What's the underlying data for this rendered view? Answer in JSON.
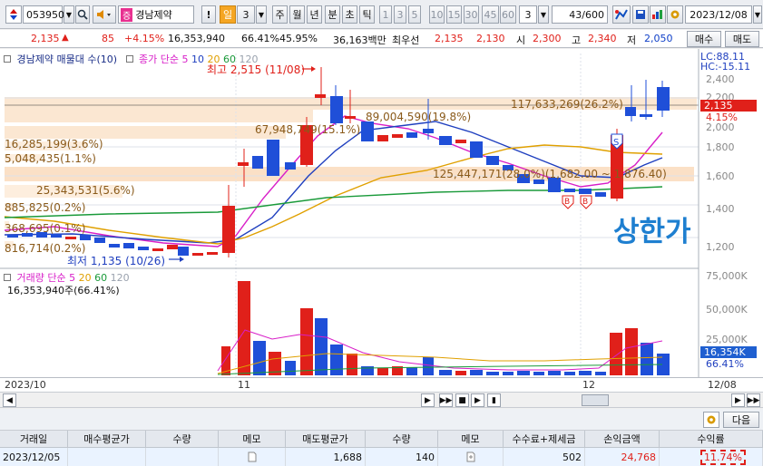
{
  "toolbar": {
    "code": "053950",
    "market_badge": "증",
    "stock_name": "경남제약",
    "exclaim": "!",
    "period_days": "일",
    "period_value": "3",
    "periods": [
      "주",
      "월",
      "년",
      "분",
      "초",
      "틱"
    ],
    "minutes": [
      "1",
      "3",
      "5",
      "10",
      "15",
      "30",
      "45",
      "60"
    ],
    "select_value": "3",
    "count": "43",
    "count_total": "/600",
    "date": "2023/12/08"
  },
  "info": {
    "price": "2,135",
    "change_arrow": "▲",
    "change": "85",
    "change_pct": "+4.15%",
    "volume": "16,353,940",
    "ratio1": "66.41%",
    "ratio2": "45.95%",
    "amount": "36,163백만",
    "best_offer_label": "최우선",
    "best_ask": "2,135",
    "best_bid": "2,130",
    "open_label": "시",
    "open": "2,300",
    "high_label": "고",
    "high": "2,340",
    "low_label": "저",
    "low": "2,050",
    "buy_button": "매수",
    "sell_button": "매도"
  },
  "chart": {
    "title": "경남제약 매물대 수(10)",
    "ma_label": "종가 단순",
    "ma_periods": [
      "5",
      "10",
      "20",
      "60",
      "120"
    ],
    "ma_colors": [
      "#d81ec8",
      "#1f3fbf",
      "#e0a000",
      "#1a9a3a",
      "#9aa2ae"
    ],
    "lc": "LC:88.11",
    "hc": "HC:-15.11",
    "price_axis": [
      "2,400",
      "2,200",
      "2,000",
      "1,800",
      "1,600",
      "1,400",
      "1,200"
    ],
    "current_price_tag": "2,135",
    "current_pct_tag": "4.15%",
    "high_marker": "최고 2,515 (11/08)",
    "low_marker": "최저 1,135 (10/26)",
    "upper_limit_label": "상한가",
    "volume_profile": [
      "117,633,269(26.2%)",
      "89,004,590(19.8%)",
      "67,948,749(15.1%)",
      "16,285,199(3.6%)",
      "5,048,435(1.1%)",
      "125,447,171(28.0%)",
      "25,343,531(5.6%)",
      "885,825(0.2%)",
      "368,695(0.1%)",
      "816,714(0.2%)"
    ],
    "range_text": "(1,682.00 ~ 1,876.40)",
    "volume_title": "거래량 단순",
    "volume_periods": [
      "5",
      "20",
      "60",
      "120"
    ],
    "volume_today": "16,353,940주(66.41%)",
    "volume_axis": [
      "75,000K",
      "50,000K",
      "25,000K"
    ],
    "volume_tag": "16,354K",
    "volume_pct_tag": "66.41%",
    "x_axis": [
      "2023/10",
      "11",
      "12",
      "12/08"
    ],
    "badges": [
      "S",
      "B",
      "B"
    ]
  },
  "bottom": {
    "next_button": "다음",
    "headers": [
      "거래일",
      "매수평균가",
      "수량",
      "메모",
      "매도평균가",
      "수량",
      "메모",
      "수수료+제세금",
      "손익금액",
      "수익률"
    ],
    "row": [
      "2023/12/05",
      "",
      "",
      "",
      "1,688",
      "140",
      "",
      "502",
      "24,768",
      "11.74%"
    ]
  }
}
